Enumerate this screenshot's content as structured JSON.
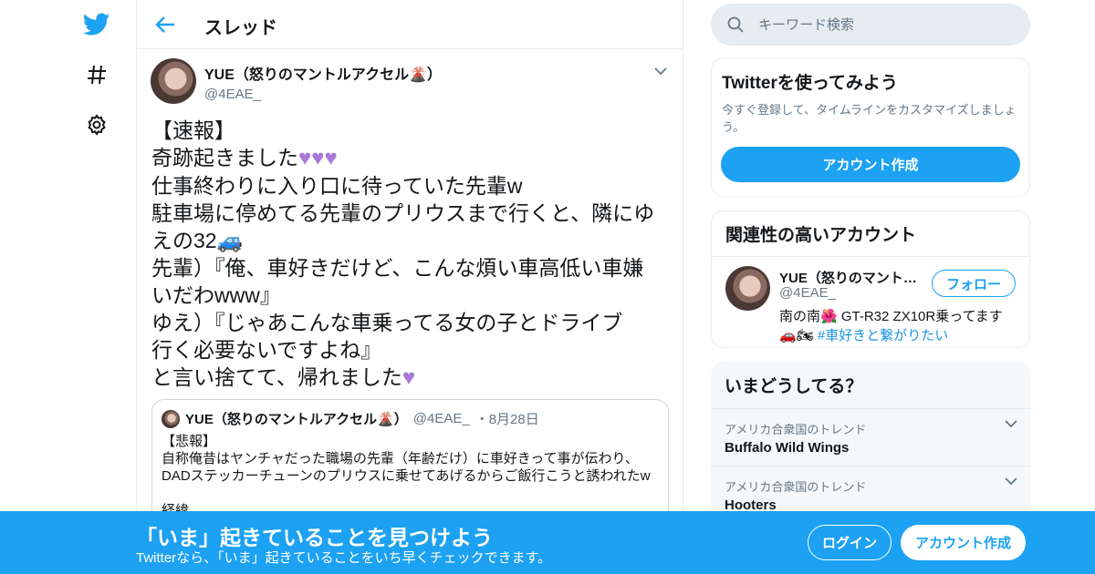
{
  "nav": {
    "logo": "twitter-bird-icon",
    "explore": "hashtag-icon",
    "settings": "gear-icon"
  },
  "header": {
    "title": "スレッド"
  },
  "tweet": {
    "author_name": "YUE（怒りのマントルアクセル🌋）",
    "author_handle": "@4EAE_",
    "lines": [
      "【速報】",
      "奇跡起きました💜💜💜",
      "仕事終わりに入り口に待っていた先輩w",
      "駐車場に停めてる先輩のプリウスまで行くと、隣にゆ",
      "えの32🚙",
      "先輩）『俺、車好きだけど、こんな煩い車高低い車嫌",
      "いだわwww』",
      "ゆえ）『じゃあこんな車乗ってる女の子とドライブ",
      "行く必要ないですよね』",
      "と言い捨てて、帰れました💜"
    ]
  },
  "quote": {
    "author_name": "YUE（怒りのマントルアクセル🌋）",
    "author_handle": "@4EAE_",
    "date": "・8月28日",
    "lines": [
      "【悲報】",
      "自称俺昔はヤンチャだった職場の先輩（年齢だけ）に車好きって事が伝わり、",
      "DADステッカーチューンのプリウスに乗せてあげるからご飯行こうと誘われたw",
      "",
      "経緯"
    ]
  },
  "search": {
    "placeholder": "キーワード検索"
  },
  "signup_card": {
    "title": "Twitterを使ってみよう",
    "subtitle": "今すぐ登録して、タイムラインをカスタマイズしましょう。",
    "button": "アカウント作成"
  },
  "related": {
    "title": "関連性の高いアカウント",
    "name": "YUE（怒りのマントルアクセル🌋）",
    "handle": "@4EAE_",
    "follow": "フォロー",
    "bio_text": "南の南🌺 GT-R32 ZX10R乗ってます🚗🏍",
    "bio_tag": "#車好きと繋がりたい"
  },
  "trends": {
    "title": "いまどうしてる？",
    "items": [
      {
        "context": "アメリカ合衆国のトレンド",
        "name": "Buffalo Wild Wings"
      },
      {
        "context": "アメリカ合衆国のトレンド",
        "name": "Hooters"
      }
    ]
  },
  "banner": {
    "title": "「いま」起きていることを見つけよう",
    "subtitle": "Twitterなら、「いま」起きていることをいち早くチェックできます。",
    "login": "ログイン",
    "signup": "アカウント作成"
  },
  "colors": {
    "brand": "#1da1f2",
    "heart": "#a678d7",
    "muted": "#657786"
  }
}
